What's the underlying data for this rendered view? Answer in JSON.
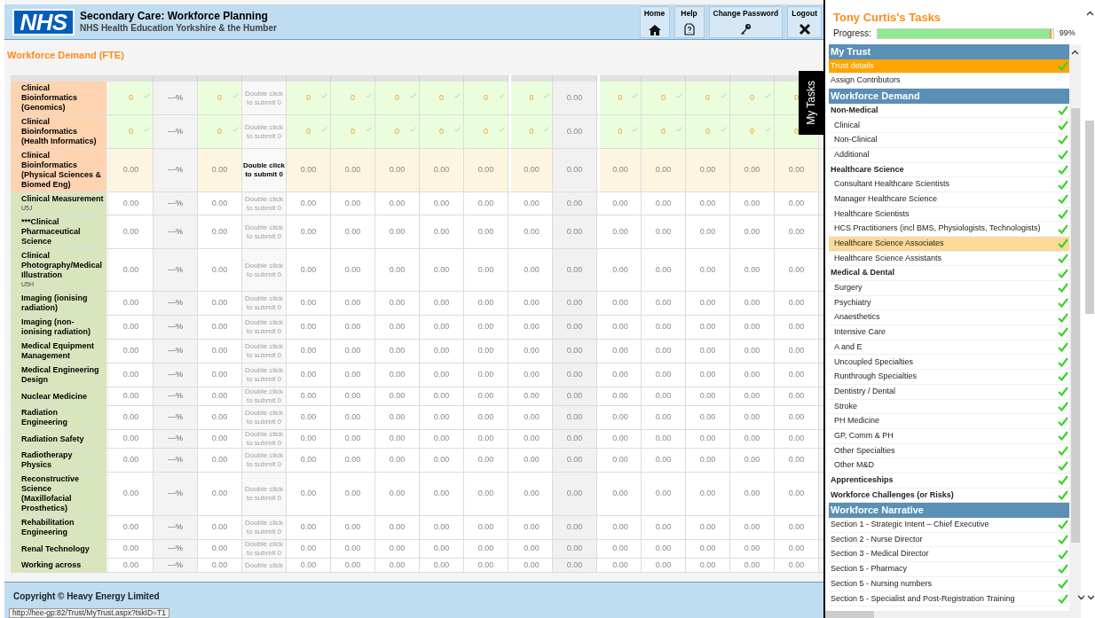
{
  "header": {
    "logo": "NHS",
    "title": "Secondary Care: Workforce Planning",
    "subtitle": "NHS Health Education Yorkshire & the Humber",
    "nav": [
      {
        "label": "Home",
        "kind": "home"
      },
      {
        "label": "Help",
        "kind": "help"
      },
      {
        "label": "Change Password",
        "kind": "password"
      },
      {
        "label": "Logout",
        "kind": "logout"
      }
    ]
  },
  "page_title": "Workforce Demand (FTE)",
  "side_tab": "My Tasks",
  "table": {
    "columns": [
      {
        "kind": "value",
        "group_start": false
      },
      {
        "kind": "percent",
        "group_start": false
      },
      {
        "kind": "value",
        "group_start": false
      },
      {
        "kind": "submit",
        "group_start": false
      },
      {
        "kind": "value",
        "group_start": false
      },
      {
        "kind": "value",
        "group_start": false
      },
      {
        "kind": "value",
        "group_start": false
      },
      {
        "kind": "value",
        "group_start": false
      },
      {
        "kind": "value",
        "group_start": false
      },
      {
        "kind": "value",
        "group_start": true
      },
      {
        "kind": "total",
        "group_start": false
      },
      {
        "kind": "value",
        "group_start": true
      },
      {
        "kind": "value",
        "group_start": false
      },
      {
        "kind": "value",
        "group_start": false
      },
      {
        "kind": "value",
        "group_start": false
      },
      {
        "kind": "value",
        "group_start": false
      }
    ],
    "rows": [
      {
        "label": "Clinical Bioinformatics (Genomics)",
        "color": "#fdd3b0",
        "kind": "saved",
        "cells": [
          "0",
          "---%",
          "0",
          "Double click to submit 0",
          "0",
          "0",
          "0",
          "0",
          "0",
          "0",
          "0.00",
          "0",
          "0",
          "0",
          "0",
          "0"
        ]
      },
      {
        "label": "Clinical Bioinformatics (Health Informatics)",
        "color": "#fdd3b0",
        "kind": "saved",
        "cells": [
          "0",
          "---%",
          "0",
          "Double click to submit 0",
          "0",
          "0",
          "0",
          "0",
          "0",
          "0",
          "0.00",
          "0",
          "0",
          "0",
          "0",
          "0"
        ]
      },
      {
        "label": "Clinical Bioinformatics (Physical Sciences & Biomed Eng)",
        "color": "#fdd3b0",
        "kind": "pending",
        "cells": [
          "0.00",
          "---%",
          "0.00",
          "Double click to submit 0",
          "0.00",
          "0.00",
          "0.00",
          "0.00",
          "0.00",
          "0.00",
          "0.00",
          "0.00",
          "0.00",
          "0.00",
          "0.00",
          "0.00"
        ]
      },
      {
        "label": "Clinical Measurement",
        "code": "U5J",
        "color": "#d9e5bd",
        "kind": "empty",
        "cells": [
          "0.00",
          "---%",
          "0.00",
          "Double click to submit 0",
          "0.00",
          "0.00",
          "0.00",
          "0.00",
          "0.00",
          "0.00",
          "0.00",
          "0.00",
          "0.00",
          "0.00",
          "0.00",
          "0.00"
        ]
      },
      {
        "label": "***Clinical Pharmaceutical Science",
        "color": "#d9e5bd",
        "kind": "empty",
        "cells": [
          "0.00",
          "---%",
          "0.00",
          "Double click to submit 0",
          "0.00",
          "0.00",
          "0.00",
          "0.00",
          "0.00",
          "0.00",
          "0.00",
          "0.00",
          "0.00",
          "0.00",
          "0.00",
          "0.00"
        ]
      },
      {
        "label": "Clinical Photography/Medical Illustration",
        "code": "U5H",
        "color": "#d9e5bd",
        "kind": "empty",
        "cells": [
          "0.00",
          "---%",
          "0.00",
          "Double click to submit 0",
          "0.00",
          "0.00",
          "0.00",
          "0.00",
          "0.00",
          "0.00",
          "0.00",
          "0.00",
          "0.00",
          "0.00",
          "0.00",
          "0.00"
        ]
      },
      {
        "label": "Imaging (ionising radiation)",
        "color": "#d9e5bd",
        "kind": "empty",
        "cells": [
          "0.00",
          "---%",
          "0.00",
          "Double click to submit 0",
          "0.00",
          "0.00",
          "0.00",
          "0.00",
          "0.00",
          "0.00",
          "0.00",
          "0.00",
          "0.00",
          "0.00",
          "0.00",
          "0.00"
        ]
      },
      {
        "label": "Imaging (non-ionising radiation)",
        "color": "#d9e5bd",
        "kind": "empty",
        "cells": [
          "0.00",
          "---%",
          "0.00",
          "Double click to submit 0",
          "0.00",
          "0.00",
          "0.00",
          "0.00",
          "0.00",
          "0.00",
          "0.00",
          "0.00",
          "0.00",
          "0.00",
          "0.00",
          "0.00"
        ]
      },
      {
        "label": "Medical Equipment Management",
        "color": "#d9e5bd",
        "kind": "empty",
        "cells": [
          "0.00",
          "---%",
          "0.00",
          "Double click to submit 0",
          "0.00",
          "0.00",
          "0.00",
          "0.00",
          "0.00",
          "0.00",
          "0.00",
          "0.00",
          "0.00",
          "0.00",
          "0.00",
          "0.00"
        ]
      },
      {
        "label": "Medical Engineering Design",
        "color": "#d9e5bd",
        "kind": "empty",
        "cells": [
          "0.00",
          "---%",
          "0.00",
          "Double click to submit 0",
          "0.00",
          "0.00",
          "0.00",
          "0.00",
          "0.00",
          "0.00",
          "0.00",
          "0.00",
          "0.00",
          "0.00",
          "0.00",
          "0.00"
        ]
      },
      {
        "label": "Nuclear Medicine",
        "color": "#d9e5bd",
        "kind": "empty",
        "cells": [
          "0.00",
          "---%",
          "0.00",
          "Double click to submit 0",
          "0.00",
          "0.00",
          "0.00",
          "0.00",
          "0.00",
          "0.00",
          "0.00",
          "0.00",
          "0.00",
          "0.00",
          "0.00",
          "0.00"
        ]
      },
      {
        "label": "Radiation Engineering",
        "color": "#d9e5bd",
        "kind": "empty",
        "cells": [
          "0.00",
          "---%",
          "0.00",
          "Double click to submit 0",
          "0.00",
          "0.00",
          "0.00",
          "0.00",
          "0.00",
          "0.00",
          "0.00",
          "0.00",
          "0.00",
          "0.00",
          "0.00",
          "0.00"
        ]
      },
      {
        "label": "Radiation Safety",
        "color": "#d9e5bd",
        "kind": "empty",
        "cells": [
          "0.00",
          "---%",
          "0.00",
          "Double click to submit 0",
          "0.00",
          "0.00",
          "0.00",
          "0.00",
          "0.00",
          "0.00",
          "0.00",
          "0.00",
          "0.00",
          "0.00",
          "0.00",
          "0.00"
        ]
      },
      {
        "label": "Radiotherapy Physics",
        "color": "#d9e5bd",
        "kind": "empty",
        "cells": [
          "0.00",
          "---%",
          "0.00",
          "Double click to submit 0",
          "0.00",
          "0.00",
          "0.00",
          "0.00",
          "0.00",
          "0.00",
          "0.00",
          "0.00",
          "0.00",
          "0.00",
          "0.00",
          "0.00"
        ]
      },
      {
        "label": "Reconstructive Science (Maxillofacial Prosthetics)",
        "color": "#d9e5bd",
        "kind": "empty",
        "cells": [
          "0.00",
          "---%",
          "0.00",
          "Double click to submit 0",
          "0.00",
          "0.00",
          "0.00",
          "0.00",
          "0.00",
          "0.00",
          "0.00",
          "0.00",
          "0.00",
          "0.00",
          "0.00",
          "0.00"
        ]
      },
      {
        "label": "Rehabilitation Engineering",
        "color": "#d9e5bd",
        "kind": "empty",
        "cells": [
          "0.00",
          "---%",
          "0.00",
          "Double click to submit 0",
          "0.00",
          "0.00",
          "0.00",
          "0.00",
          "0.00",
          "0.00",
          "0.00",
          "0.00",
          "0.00",
          "0.00",
          "0.00",
          "0.00"
        ]
      },
      {
        "label": "Renal Technology",
        "color": "#d9e5bd",
        "kind": "empty",
        "cells": [
          "0.00",
          "---%",
          "0.00",
          "Double click to submit 0",
          "0.00",
          "0.00",
          "0.00",
          "0.00",
          "0.00",
          "0.00",
          "0.00",
          "0.00",
          "0.00",
          "0.00",
          "0.00",
          "0.00"
        ]
      },
      {
        "label": "Working across",
        "color": "#d9e5bd",
        "kind": "empty",
        "cells": [
          "0.00",
          "---%",
          "0.00",
          "Double click",
          "0.00",
          "0.00",
          "0.00",
          "0.00",
          "0.00",
          "0.00",
          "0.00",
          "0.00",
          "0.00",
          "0.00",
          "0.00",
          "0.00"
        ]
      }
    ]
  },
  "footer": "Copyright © Heavy Energy Limited",
  "status_url": "http://hee-gp:82/Trust/MyTrust.aspx?tskID=T1",
  "task_panel": {
    "title": "Tony Curtis's Tasks",
    "progress_label": "Progress:",
    "progress": {
      "level": 0.99,
      "reading": "99%"
    },
    "sections": [
      {
        "title": "My Trust",
        "items": [
          {
            "label": "Trust details",
            "kind": "task",
            "done": true,
            "selected": true,
            "hovered": false
          },
          {
            "label": "Assign Contributors",
            "kind": "task",
            "done": false,
            "selected": false,
            "hovered": false
          }
        ]
      },
      {
        "title": "Workforce Demand",
        "items": [
          {
            "label": "Non-Medical",
            "kind": "heading",
            "done": true,
            "selected": false,
            "hovered": false,
            "children": [
              {
                "label": "Clinical",
                "kind": "task",
                "done": true,
                "selected": false,
                "hovered": false
              },
              {
                "label": "Non-Clinical",
                "kind": "task",
                "done": true,
                "selected": false,
                "hovered": false
              },
              {
                "label": "Additional",
                "kind": "task",
                "done": true,
                "selected": false,
                "hovered": false
              }
            ]
          },
          {
            "label": "Healthcare Science",
            "kind": "heading",
            "done": true,
            "selected": false,
            "hovered": false,
            "children": [
              {
                "label": "Consultant Healthcare Scientists",
                "kind": "task",
                "done": true,
                "selected": false,
                "hovered": false
              },
              {
                "label": "Manager Healthcare Science",
                "kind": "task",
                "done": true,
                "selected": false,
                "hovered": false
              },
              {
                "label": "Healthcare Scientists",
                "kind": "task",
                "done": true,
                "selected": false,
                "hovered": false
              },
              {
                "label": "HCS Practitioners (incl BMS, Physiologists, Technologists)",
                "kind": "task",
                "done": true,
                "selected": false,
                "hovered": false
              },
              {
                "label": "Healthcare Science Associates",
                "kind": "task",
                "done": true,
                "selected": false,
                "hovered": true
              },
              {
                "label": "Healthcare Science Assistants",
                "kind": "task",
                "done": true,
                "selected": false,
                "hovered": false
              }
            ]
          },
          {
            "label": "Medical & Dental",
            "kind": "heading",
            "done": true,
            "selected": false,
            "hovered": false,
            "children": [
              {
                "label": "Surgery",
                "kind": "task",
                "done": true,
                "selected": false,
                "hovered": false
              },
              {
                "label": "Psychiatry",
                "kind": "task",
                "done": true,
                "selected": false,
                "hovered": false
              },
              {
                "label": "Anaesthetics",
                "kind": "task",
                "done": true,
                "selected": false,
                "hovered": false
              },
              {
                "label": "Intensive Care",
                "kind": "task",
                "done": true,
                "selected": false,
                "hovered": false
              },
              {
                "label": "A and E",
                "kind": "task",
                "done": true,
                "selected": false,
                "hovered": false
              },
              {
                "label": "Uncoupled Specialties",
                "kind": "task",
                "done": true,
                "selected": false,
                "hovered": false
              },
              {
                "label": "Runthrough Specialties",
                "kind": "task",
                "done": true,
                "selected": false,
                "hovered": false
              },
              {
                "label": "Dentistry / Dental",
                "kind": "task",
                "done": true,
                "selected": false,
                "hovered": false
              },
              {
                "label": "Stroke",
                "kind": "task",
                "done": true,
                "selected": false,
                "hovered": false
              },
              {
                "label": "PH Medicine",
                "kind": "task",
                "done": true,
                "selected": false,
                "hovered": false
              },
              {
                "label": "GP, Comm & PH",
                "kind": "task",
                "done": true,
                "selected": false,
                "hovered": false
              },
              {
                "label": "Other Specialties",
                "kind": "task",
                "done": true,
                "selected": false,
                "hovered": false
              },
              {
                "label": "Other M&D",
                "kind": "task",
                "done": true,
                "selected": false,
                "hovered": false
              }
            ]
          },
          {
            "label": "Apprenticeships",
            "kind": "heading",
            "done": true,
            "selected": false,
            "hovered": false
          },
          {
            "label": "Workforce Challenges (or Risks)",
            "kind": "heading",
            "done": true,
            "selected": false,
            "hovered": false
          }
        ]
      },
      {
        "title": "Workforce Narrative",
        "items": [
          {
            "label": "Section 1 - Strategic Intent – Chief Executive",
            "kind": "task",
            "done": true,
            "selected": false,
            "hovered": false
          },
          {
            "label": "Section 2 - Nurse Director",
            "kind": "task",
            "done": true,
            "selected": false,
            "hovered": false
          },
          {
            "label": "Section 3 - Medical Director",
            "kind": "task",
            "done": true,
            "selected": false,
            "hovered": false
          },
          {
            "label": "Section 5 - Pharmacy",
            "kind": "task",
            "done": true,
            "selected": false,
            "hovered": false
          },
          {
            "label": "Section 5 - Nursing numbers",
            "kind": "task",
            "done": true,
            "selected": false,
            "hovered": false
          },
          {
            "label": "Section 5 - Specialist and Post-Registration Training",
            "kind": "task",
            "done": true,
            "selected": false,
            "hovered": false
          }
        ]
      }
    ]
  }
}
